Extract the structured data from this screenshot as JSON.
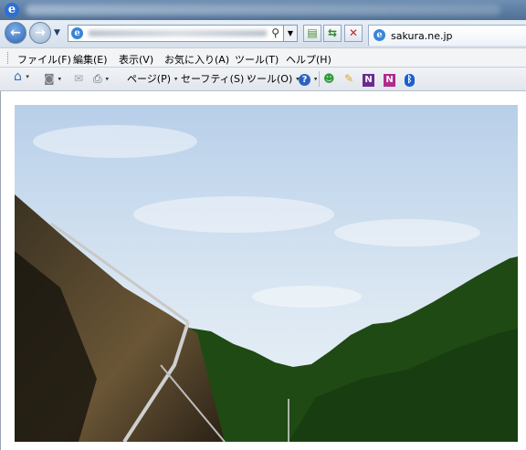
{
  "window": {
    "title_icon": "ie-logo-icon",
    "title_letter": "e"
  },
  "navbar": {
    "back_icon": "back-arrow-icon",
    "back_glyph": "←",
    "forward_icon": "forward-arrow-icon",
    "forward_glyph": "→",
    "history_glyph": "▼",
    "address_icon": "ie-page-icon",
    "address_icon_letter": "e",
    "search_glyph": "⚲",
    "dropdown_glyph": "▼",
    "compat_glyph": "▤",
    "refresh_glyph": "⇆",
    "stop_glyph": "✕"
  },
  "tab": {
    "label": "sakura.ne.jp",
    "icon_letter": "e"
  },
  "menubar": {
    "items": [
      "ファイル(F)",
      "編集(E)",
      "表示(V)",
      "お気に入り(A)",
      "ツール(T)",
      "ヘルプ(H)"
    ]
  },
  "commandbar": {
    "home_glyph": "⌂",
    "feeds_glyph": "◙",
    "mail_glyph": "✉",
    "print_glyph": "⎙",
    "page_label": "ページ(P)",
    "safety_label": "セーフティ(S)",
    "tools_label": "ツール(O)",
    "help_glyph": "?",
    "messenger_glyph": "☻",
    "pen_glyph": "✎",
    "onenote_n1": "N",
    "onenote_n2": "N",
    "bluetooth_glyph": "ᛒ",
    "dropdown_glyph": "▾"
  },
  "colors": {
    "sky_top": "#b8cfe9",
    "sky_bottom": "#eef3f6",
    "forest": "#1f4a14",
    "tent": "#2b2418"
  }
}
